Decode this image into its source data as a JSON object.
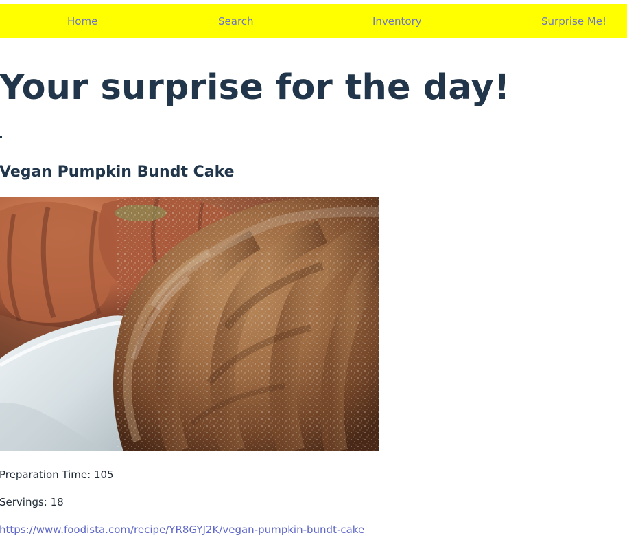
{
  "nav": {
    "home": "Home",
    "search": "Search",
    "inventory": "Inventory",
    "surprise": "Surprise Me!"
  },
  "page": {
    "title": "Your surprise for the day!"
  },
  "recipe": {
    "name": "Vegan Pumpkin Bundt Cake",
    "prep_label": "Preparation Time: 105",
    "servings_label": "Servings: 18",
    "url": "https://www.foodista.com/recipe/YR8GYJ2K/vegan-pumpkin-bundt-cake"
  },
  "colors": {
    "nav_background": "#ffff00",
    "nav_link": "#6b74c8",
    "heading": "#21364a",
    "link": "#5f68c7"
  }
}
